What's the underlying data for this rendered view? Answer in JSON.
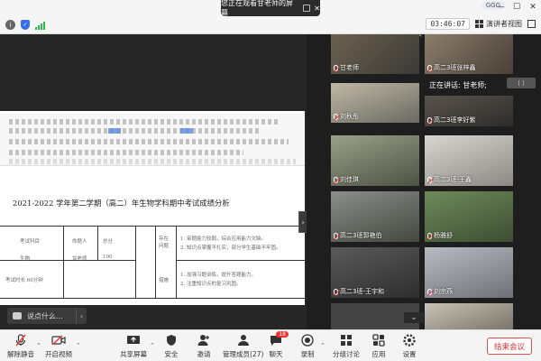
{
  "top": {
    "share_banner": "您正在观看甘老师的屏幕",
    "logo_text": "GGG",
    "timer": "03:46:07",
    "speaker_view": "演讲者视图",
    "window": {
      "min": "—",
      "max": "☐",
      "close": "✕"
    }
  },
  "shared_screen": {
    "doc_title": "2021-2022 学年第二学期（高二）年生物学科期中考试成绩分析",
    "table": {
      "cells": [
        "考试科目",
        "命题人",
        "总分",
        "生物",
        "甘老师",
        "100",
        "考试时长 60分钟"
      ],
      "side_labels": [
        "存在问题",
        "措施"
      ],
      "notes": [
        "1. 审题能力较弱，综合应用能力欠缺。",
        "2. 知识点掌握不扎实，部分学生基础不牢固。",
        "1. 加强习题训练，提升答题能力。",
        "2. 注重知识点的复习巩固。"
      ]
    },
    "say_placeholder": "说点什么...",
    "say_arrow": "‹",
    "collapse_arrow": "›"
  },
  "gallery": {
    "speaking_prefix": "正在讲话: 甘老师;",
    "more": "⌄",
    "up": "⌃",
    "float": "⟨ ⟩",
    "tiles": [
      {
        "name": "甘老师",
        "muted": true
      },
      {
        "name": "高二3班张梓鑫",
        "muted": true
      },
      {
        "name": "刘秋彤",
        "muted": true
      },
      {
        "name": "高二3班李好紫",
        "muted": true
      },
      {
        "name": "刘佳琪",
        "muted": true
      },
      {
        "name": "高二3班-王鑫",
        "muted": true
      },
      {
        "name": "高二3班郭艳伯",
        "muted": true
      },
      {
        "name": "杨雅舒",
        "muted": true
      },
      {
        "name": "高二3班-王宇和",
        "muted": true
      },
      {
        "name": "刘宗燕",
        "muted": true
      }
    ]
  },
  "toolbar": {
    "unmute": "解除静音",
    "start_video": "开启视频",
    "share_screen": "共享屏幕",
    "security": "安全",
    "invite": "邀请",
    "manage": "管理成员(27)",
    "chat": "聊天",
    "chat_badge": "18",
    "record": "录制",
    "breakout": "分组讨论",
    "apps": "应用",
    "settings": "设置",
    "end": "结束会议"
  },
  "colors": {
    "accent": "#3a6ee8",
    "danger": "#e03030"
  }
}
